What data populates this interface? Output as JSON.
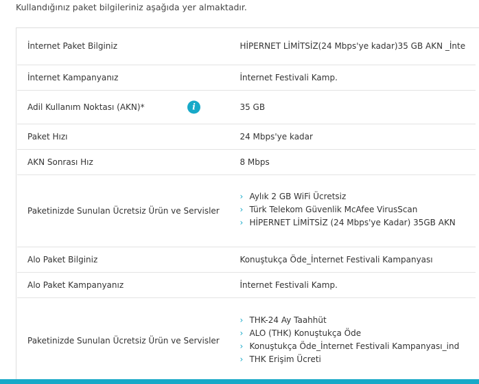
{
  "intro": "Kullandığınız paket bilgileriniz aşağıda yer almaktadır.",
  "accent_color": "#17a9c8",
  "rows": [
    {
      "label": "İnternet Paket Bilginiz",
      "value": "HİPERNET LİMİTSİZ(24 Mbps'ye kadar)35 GB AKN _İnte"
    },
    {
      "label": "İnternet Kampanyanız",
      "value": "İnternet Festivali Kamp."
    },
    {
      "label": "Adil Kullanım Noktası (AKN)*",
      "value": "35 GB",
      "icon": "info-icon",
      "icon_glyph": "i"
    },
    {
      "label": "Paket Hızı",
      "value": "24 Mbps'ye kadar"
    },
    {
      "label": "AKN Sonrası Hız",
      "value": "8 Mbps"
    },
    {
      "label": "Paketinizde Sunulan Ücretsiz Ürün ve Servisler",
      "items": [
        "Aylık 2 GB WiFi Ücretsiz",
        "Türk Telekom Güvenlik McAfee VirusScan",
        "HİPERNET LİMİTSİZ (24 Mbps'ye Kadar) 35GB AKN"
      ]
    },
    {
      "label": "Alo Paket Bilginiz",
      "value": "Konuştukça Öde_İnternet Festivali Kampanyası"
    },
    {
      "label": "Alo Paket Kampanyanız",
      "value": "İnternet Festivali Kamp."
    },
    {
      "label": "Paketinizde Sunulan Ücretsiz Ürün ve Servisler",
      "items": [
        "THK-24 Ay Taahhüt",
        "ALO (THK) Konuştukça Öde",
        "Konuştukça Öde_İnternet Festivali Kampanyası_ind",
        "THK Erişim Ücreti"
      ]
    }
  ],
  "chevron_glyph": "›"
}
